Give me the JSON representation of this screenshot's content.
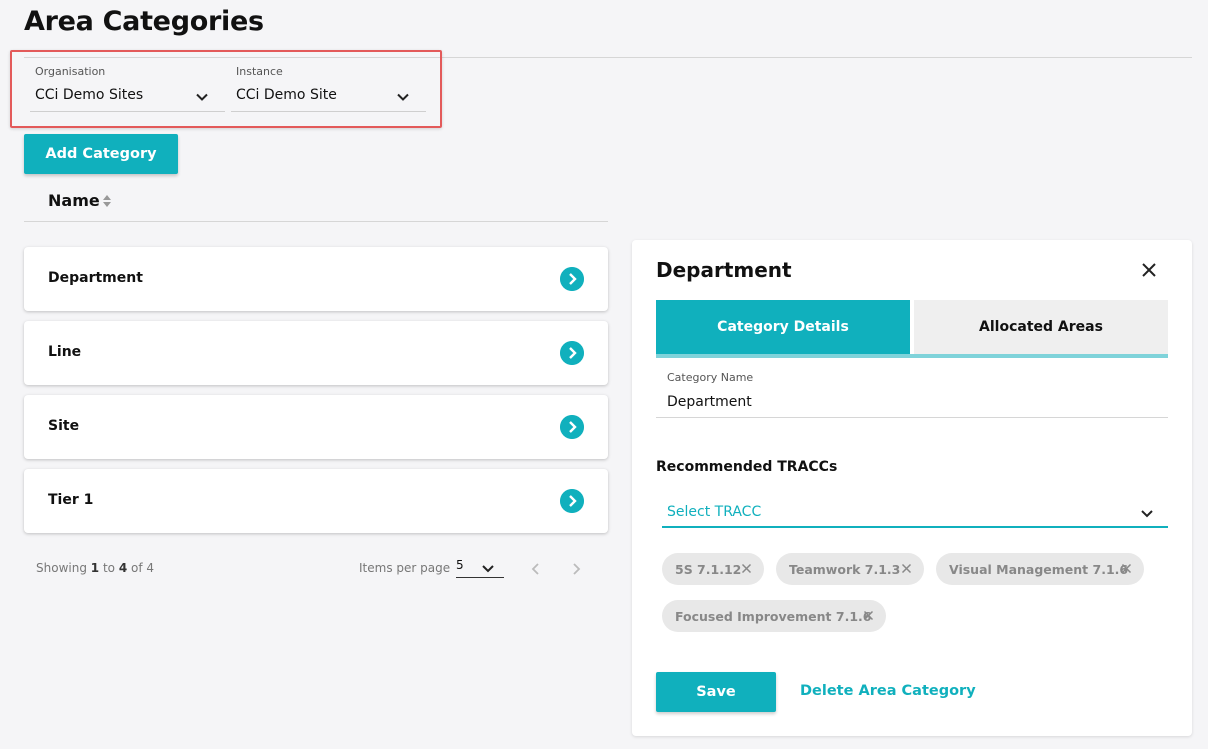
{
  "page": {
    "title": "Area Categories"
  },
  "filters": {
    "organisation": {
      "label": "Organisation",
      "value": "CCi Demo Sites"
    },
    "instance": {
      "label": "Instance",
      "value": "CCi Demo Site"
    }
  },
  "actions": {
    "add_category": "Add Category"
  },
  "list": {
    "column_name": "Name",
    "items": [
      {
        "label": "Department"
      },
      {
        "label": "Line"
      },
      {
        "label": "Site"
      },
      {
        "label": "Tier 1"
      }
    ]
  },
  "pagination": {
    "showing_prefix": "Showing",
    "from": "1",
    "to_word": "to",
    "to": "4",
    "of_word": "of",
    "total": "4",
    "items_per_page_label": "Items per page",
    "items_per_page_value": "5"
  },
  "detail": {
    "title": "Department",
    "tabs": [
      {
        "label": "Category Details",
        "active": true
      },
      {
        "label": "Allocated Areas",
        "active": false
      }
    ],
    "category_name_label": "Category Name",
    "category_name_value": "Department",
    "recommended_heading": "Recommended TRACCs",
    "select_placeholder": "Select TRACC",
    "chips": [
      {
        "label": "5S 7.1.12"
      },
      {
        "label": "Teamwork 7.1.3"
      },
      {
        "label": "Visual Management 7.1.6"
      },
      {
        "label": "Focused Improvement 7.1.6"
      }
    ],
    "save_label": "Save",
    "delete_label": "Delete Area Category"
  },
  "colors": {
    "accent": "#10b0bd",
    "highlight": "#e35a5a",
    "background": "#f5f5f7"
  },
  "icons": {
    "dropdown": "chevron-down-icon",
    "sort": "sort-icon",
    "row_action": "chevron-right-circle-icon",
    "close": "close-icon",
    "prev": "chevron-left-icon",
    "next": "chevron-right-icon",
    "chip_remove": "close-icon"
  }
}
